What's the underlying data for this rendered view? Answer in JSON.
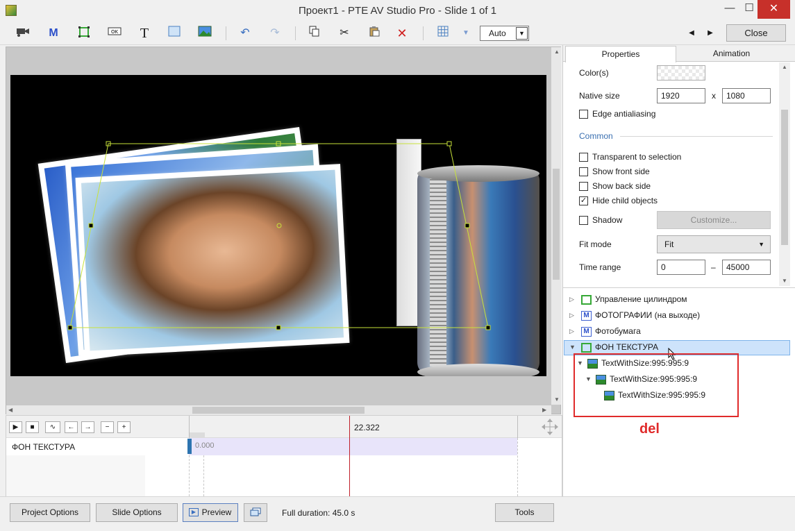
{
  "window": {
    "title": "Проект1 - PTE AV Studio Pro - Slide 1 of 1",
    "minimize": "—",
    "maximize": "☐",
    "close": "✕"
  },
  "toolbar": {
    "zoom_value": "Auto",
    "close_label": "Close"
  },
  "tabs": {
    "properties": "Properties",
    "animation": "Animation"
  },
  "properties": {
    "colors_label": "Color(s)",
    "native_size_label": "Native size",
    "native_width": "1920",
    "native_x": "x",
    "native_height": "1080",
    "edge_antialiasing": "Edge antialiasing",
    "section_common": "Common",
    "transparent_to_selection": "Transparent to selection",
    "show_front_side": "Show front side",
    "show_back_side": "Show back side",
    "hide_child_objects": "Hide child objects",
    "shadow": "Shadow",
    "customize": "Customize...",
    "fit_mode_label": "Fit mode",
    "fit_mode_value": "Fit",
    "time_range_label": "Time range",
    "time_from": "0",
    "time_dash": "–",
    "time_to": "45000",
    "checked": "✓"
  },
  "tree": {
    "items": [
      {
        "label": "Управление цилиндром"
      },
      {
        "label": "ФОТОГРАФИИ (на выходе)"
      },
      {
        "label": "Фотобумага"
      },
      {
        "label": "ФОН ТЕКСТУРА"
      },
      {
        "label": "TextWithSize:995:995:9"
      },
      {
        "label": "TextWithSize:995:995:9"
      },
      {
        "label": "TextWithSize:995:995:9"
      }
    ],
    "annotation": "del"
  },
  "timeline": {
    "marker_time": "22.322",
    "start_time": "0.000",
    "track_label": "ФОН ТЕКСТУРА"
  },
  "bottom": {
    "project_options": "Project Options",
    "slide_options": "Slide Options",
    "preview": "Preview",
    "full_duration": "Full duration: 45.0 s",
    "tools": "Tools"
  },
  "colors": {
    "selection_green": "#c8e23a",
    "selected_row": "#cde3fb",
    "annotation_red": "#e02a2a",
    "timeline_playhead": "#c0202a"
  }
}
